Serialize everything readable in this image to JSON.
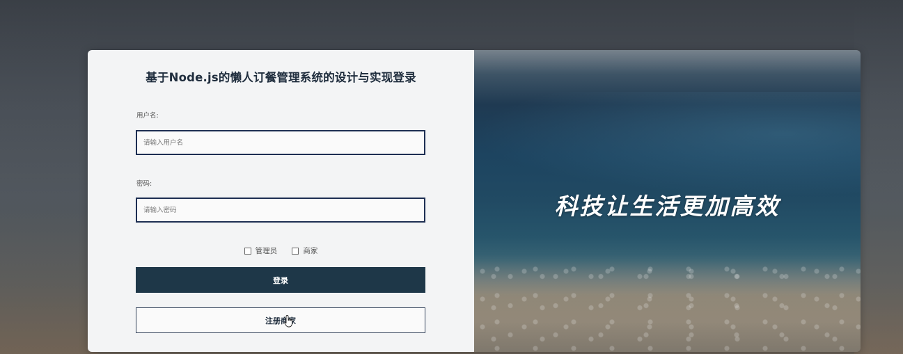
{
  "login": {
    "title": "基于Node.js的懒人订餐管理系统的设计与实现登录",
    "username_label": "用户名:",
    "username_placeholder": "请输入用户名",
    "password_label": "密码:",
    "password_placeholder": "请输入密码",
    "roles": [
      "管理员",
      "商家"
    ],
    "login_button": "登录",
    "register_button": "注册商家"
  },
  "banner": {
    "slogan": "科技让生活更加高效"
  },
  "colors": {
    "primary_button": "#1e3748",
    "input_border": "#1d2e52",
    "form_bg": "#f3f4f5"
  }
}
